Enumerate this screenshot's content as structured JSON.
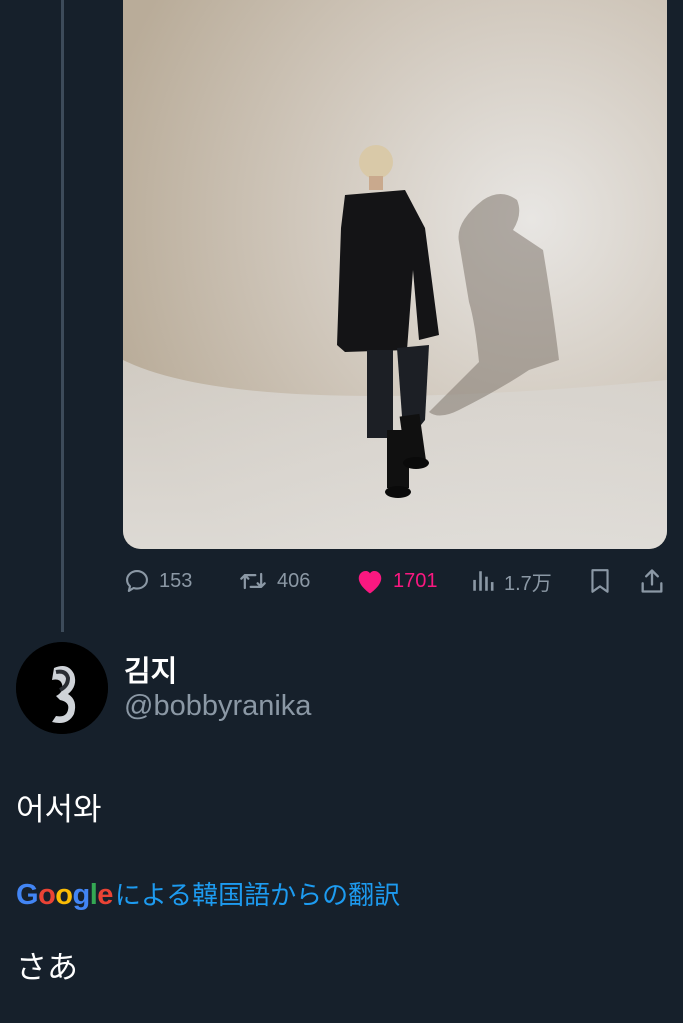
{
  "tweet_actions": {
    "replies": "153",
    "retweets": "406",
    "likes": "1701",
    "views": "1.7万",
    "reply_icon": "speech-bubble",
    "retweet_icon": "retweet-arrows",
    "like_icon": "heart-filled",
    "views_icon": "bar-chart",
    "bookmark_icon": "bookmark",
    "share_icon": "share-upload"
  },
  "colors": {
    "background": "#16202b",
    "muted": "#8b98a5",
    "like": "#f91880",
    "link": "#1d9bf0"
  },
  "reply": {
    "name": "김지",
    "handle": "@bobbyranika",
    "text": "어서와",
    "translation": {
      "brand": "Google",
      "label": "による韓国語からの翻訳",
      "text": "さあ"
    }
  }
}
